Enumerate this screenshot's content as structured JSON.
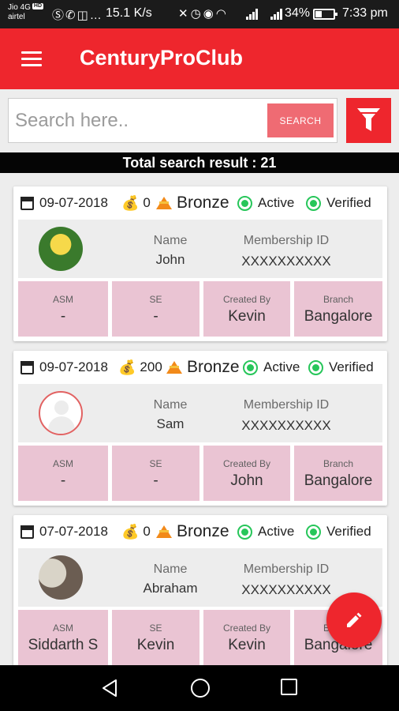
{
  "status_bar": {
    "carrier1": "Jio 4G",
    "carrier1_badge": "HD",
    "carrier2": "airtel",
    "speed": "15.1 K/s",
    "battery": "34%",
    "battery_level": 0.34,
    "time": "7:33 pm"
  },
  "app": {
    "title": "CenturyProClub"
  },
  "search": {
    "placeholder": "Search here..",
    "value": "",
    "button_label": "SEARCH"
  },
  "results": {
    "summary": "Total search result : 21"
  },
  "labels": {
    "name": "Name",
    "membership_id": "Membership ID",
    "asm": "ASM",
    "se": "SE",
    "created_by": "Created By",
    "branch": "Branch"
  },
  "members": [
    {
      "date": "09-07-2018",
      "points": "0",
      "tier": "Bronze",
      "status": "Active",
      "verification": "Verified",
      "name": "John",
      "membership_id": "XXXXXXXXXX",
      "asm": "-",
      "se": "-",
      "created_by": "Kevin",
      "branch": "Bangalore",
      "avatar": "photo"
    },
    {
      "date": "09-07-2018",
      "points": "200",
      "tier": "Bronze",
      "status": "Active",
      "verification": "Verified",
      "name": "Sam",
      "membership_id": "XXXXXXXXXX",
      "asm": "-",
      "se": "-",
      "created_by": "John",
      "branch": "Bangalore",
      "avatar": "placeholder"
    },
    {
      "date": "07-07-2018",
      "points": "0",
      "tier": "Bronze",
      "status": "Active",
      "verification": "Verified",
      "name": "Abraham",
      "membership_id": "XXXXXXXXXX",
      "asm": "Siddarth S",
      "se": "Kevin",
      "created_by": "Kevin",
      "branch": "Bangalore",
      "avatar": "photo"
    }
  ],
  "colors": {
    "primary": "#ee262d",
    "search_button": "#ef6b73",
    "footer_cells": "#eac4d3",
    "status_green": "#27c65a"
  },
  "icons": {
    "menu": "hamburger-menu-icon",
    "filter": "filter-funnel-icon",
    "date": "calendar-icon",
    "points": "money-bag-icon",
    "tier": "bronze-tier-icon",
    "status": "radio-check-icon",
    "fab": "edit-pencil-icon",
    "nav": [
      "back-triangle-icon",
      "home-circle-icon",
      "recents-square-icon"
    ]
  }
}
